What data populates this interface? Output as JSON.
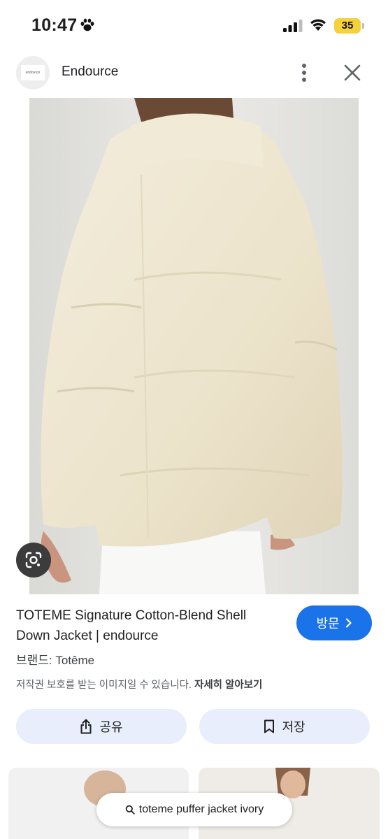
{
  "status_bar": {
    "time": "10:47",
    "battery": "35",
    "battery_color": "#f5d13b"
  },
  "header": {
    "site_logo_text": "endource",
    "site_name": "Endource"
  },
  "image": {
    "lens_icon": "google-lens-icon"
  },
  "product": {
    "title": "TOTEME Signature Cotton-Blend Shell Down Jacket | endource",
    "visit_label": "방문",
    "brand": "브랜드: Totême",
    "copyright_text": "저작권 보호를 받는 이미지일 수 있습니다. ",
    "learn_more": "자세히 알아보기"
  },
  "actions": {
    "share_label": "공유",
    "save_label": "저장"
  },
  "search_chip": {
    "query": "toteme puffer jacket ivory"
  },
  "colors": {
    "accent": "#1a73e8",
    "action_bg": "#e8eefc"
  }
}
